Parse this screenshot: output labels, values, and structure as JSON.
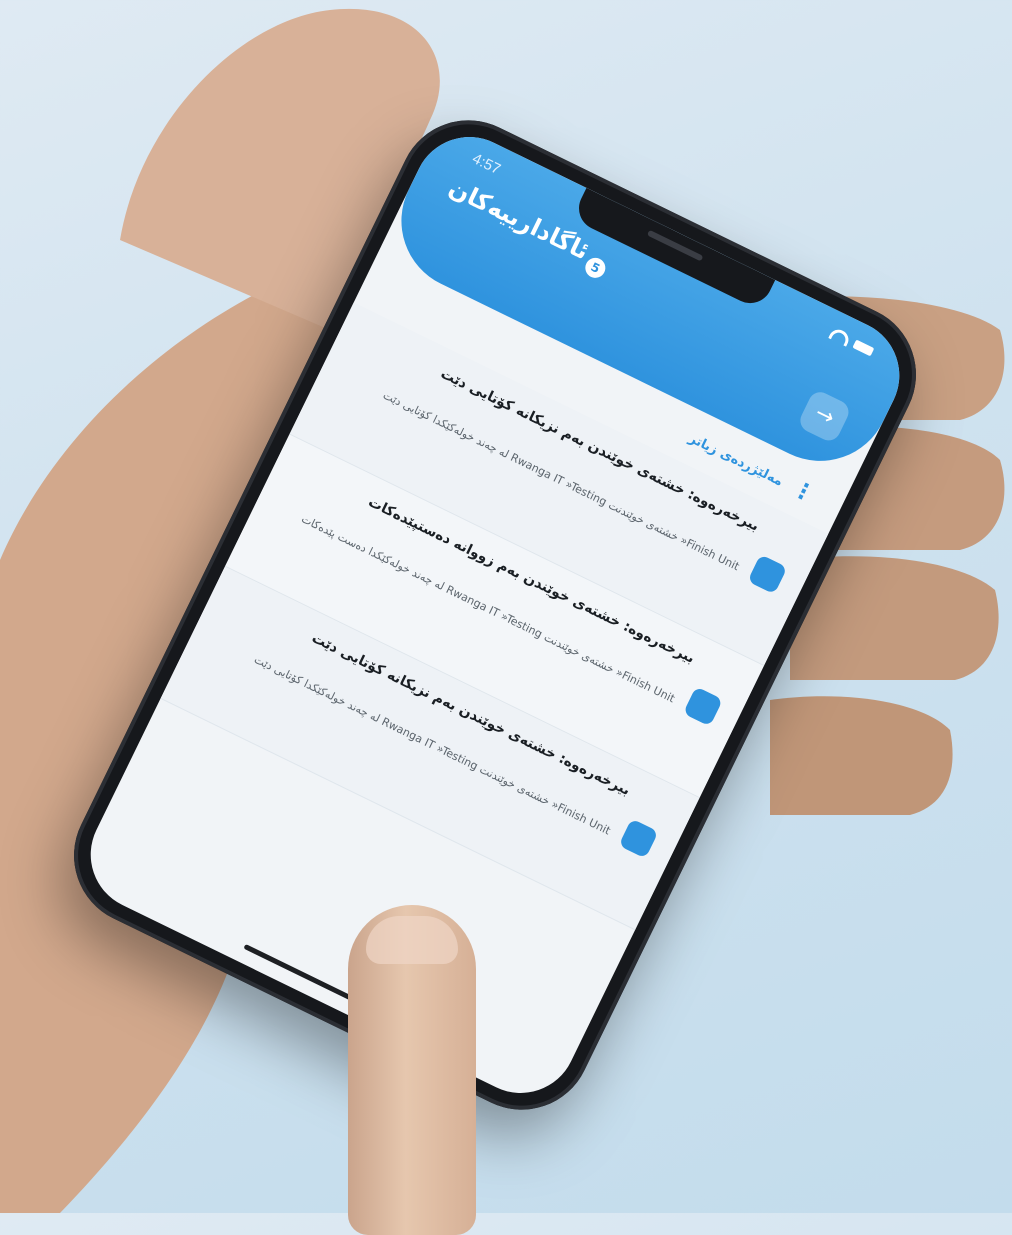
{
  "status": {
    "time": "4:57"
  },
  "header": {
    "title": "ئاگادارییەکان",
    "badge_count": "5",
    "back_icon": "arrow-right-icon"
  },
  "actions": {
    "more_label": "مەلێژردەی زیاتر"
  },
  "notifications": [
    {
      "title": "بیرخەرەوە: خشتەی خوێندن بەم نزیکانە کۆتایی دێت",
      "body": "Finish Unit« خشتەی خوێندنت Rwanga IT »Testing لە چەند خولەکێکدا کۆتایی دێت",
      "date": ""
    },
    {
      "title": "بیرخەرەوە: خشتەی خوێندن بەم زووانە دەستپێدەکات",
      "body": "Finish Unit« خشتەی خوێندنت Rwanga IT »Testing لە چەند خولەکێکدا دەست پێدەکات",
      "date": ""
    },
    {
      "title": "بیرخەرەوە: خشتەی خوێندن بەم نزیکانە کۆتایی دێت",
      "body": "Finish Unit« خشتەی خوێندنت Rwanga IT »Testing لە چەند خولەکێکدا کۆتایی دێت",
      "date": ""
    }
  ],
  "colors": {
    "accent": "#2f93de",
    "background": "#f1f4f7"
  }
}
